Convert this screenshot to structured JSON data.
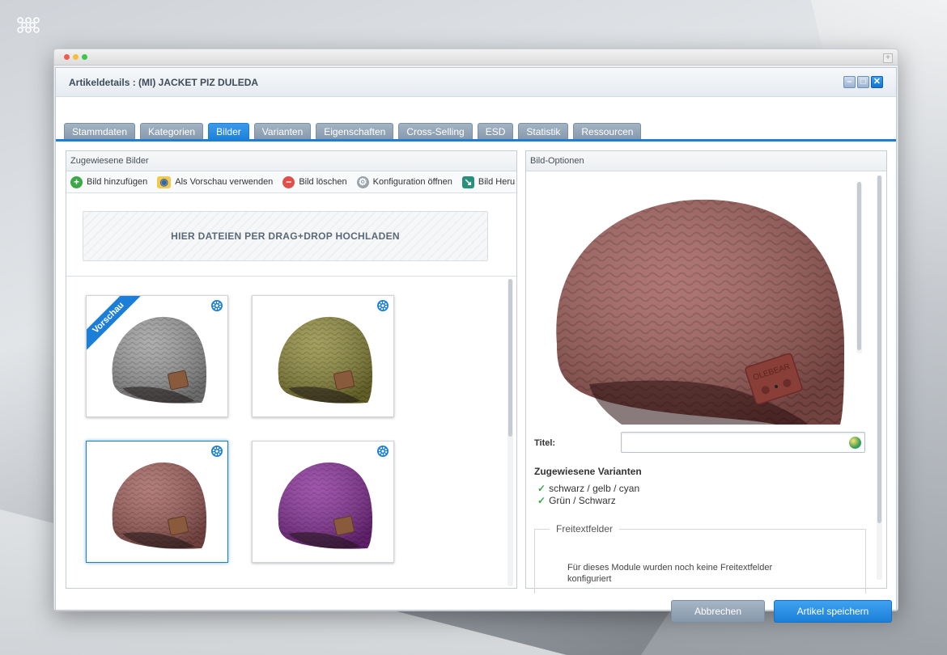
{
  "dialog": {
    "title": "Artikeldetails : (MI) JACKET PIZ DULEDA"
  },
  "tabs": [
    {
      "label": "Stammdaten",
      "active": false
    },
    {
      "label": "Kategorien",
      "active": false
    },
    {
      "label": "Bilder",
      "active": true
    },
    {
      "label": "Varianten",
      "active": false
    },
    {
      "label": "Eigenschaften",
      "active": false
    },
    {
      "label": "Cross-Selling",
      "active": false
    },
    {
      "label": "ESD",
      "active": false
    },
    {
      "label": "Statistik",
      "active": false
    },
    {
      "label": "Ressourcen",
      "active": false
    }
  ],
  "left_panel": {
    "title": "Zugewiesene Bilder",
    "toolbar": {
      "add": "Bild hinzufügen",
      "preview": "Als Vorschau verwenden",
      "delete": "Bild löschen",
      "config": "Konfiguration öffnen",
      "download": "Bild Heru"
    },
    "dropzone": "HIER DATEIEN PER DRAG+DROP HOCHLADEN",
    "images": [
      {
        "color": "#9c9c9c",
        "preview": true,
        "selected": false,
        "icon": "beanie-grey"
      },
      {
        "color": "#8f8a3a",
        "preview": false,
        "selected": false,
        "icon": "beanie-olive"
      },
      {
        "color": "#a25f5b",
        "preview": false,
        "selected": true,
        "icon": "beanie-rose"
      },
      {
        "color": "#8a2f9a",
        "preview": false,
        "selected": false,
        "icon": "beanie-purple"
      }
    ],
    "preview_badge": "Vorschau"
  },
  "right_panel": {
    "title": "Bild-Optionen",
    "preview_color": "#a25f5b",
    "brand_label": "OLEBEAR",
    "titel_label": "Titel:",
    "titel_value": "",
    "variants_heading": "Zugewiesene Varianten",
    "variants": [
      "schwarz / gelb / cyan",
      "Grün / Schwarz"
    ],
    "freetext_legend": "Freitextfelder",
    "freetext_message": "Für dieses Module wurden noch keine Freitextfelder konfiguriert"
  },
  "buttons": {
    "cancel": "Abbrechen",
    "save": "Artikel speichern"
  }
}
